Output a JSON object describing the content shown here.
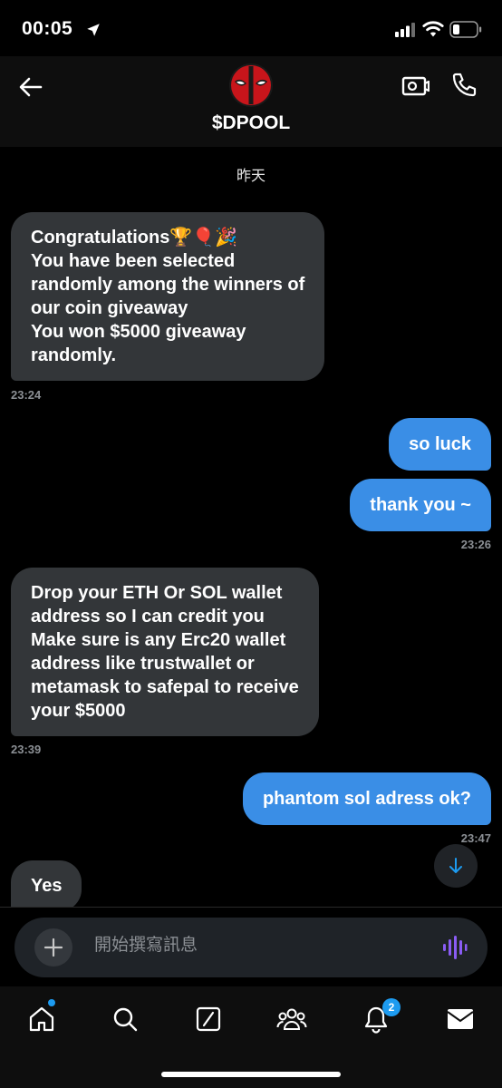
{
  "status_bar": {
    "time": "00:05"
  },
  "header": {
    "contact_name": "$DPOOL"
  },
  "chat": {
    "day_label": "昨天",
    "messages": [
      {
        "direction": "in",
        "text": "Congratulations🏆🎈🎉\nYou have been  selected\nrandomly among the winners of\nour coin giveaway\nYou won $5000 giveaway\nrandomly.",
        "time": "23:24"
      },
      {
        "direction": "out",
        "text": "so luck",
        "time": ""
      },
      {
        "direction": "out",
        "text": "thank you ~",
        "time": "23:26"
      },
      {
        "direction": "in",
        "text": "Drop your ETH Or  SOL wallet\naddress so I can credit you\nMake sure is any Erc20 wallet\naddress like trustwallet or\nmetamask to safepal to receive\nyour $5000",
        "time": "23:39"
      },
      {
        "direction": "out",
        "text": "phantom sol adress ok?",
        "time": "23:47"
      },
      {
        "direction": "in",
        "text": "Yes",
        "time": ""
      }
    ]
  },
  "composer": {
    "placeholder": "開始撰寫訊息"
  },
  "tabbar": {
    "notifications_badge": "2"
  },
  "colors": {
    "outgoing_bubble": "#3a8ee6",
    "incoming_bubble": "#333639",
    "accent": "#1d9bf0",
    "voice_icon": "#8a5cf5"
  }
}
